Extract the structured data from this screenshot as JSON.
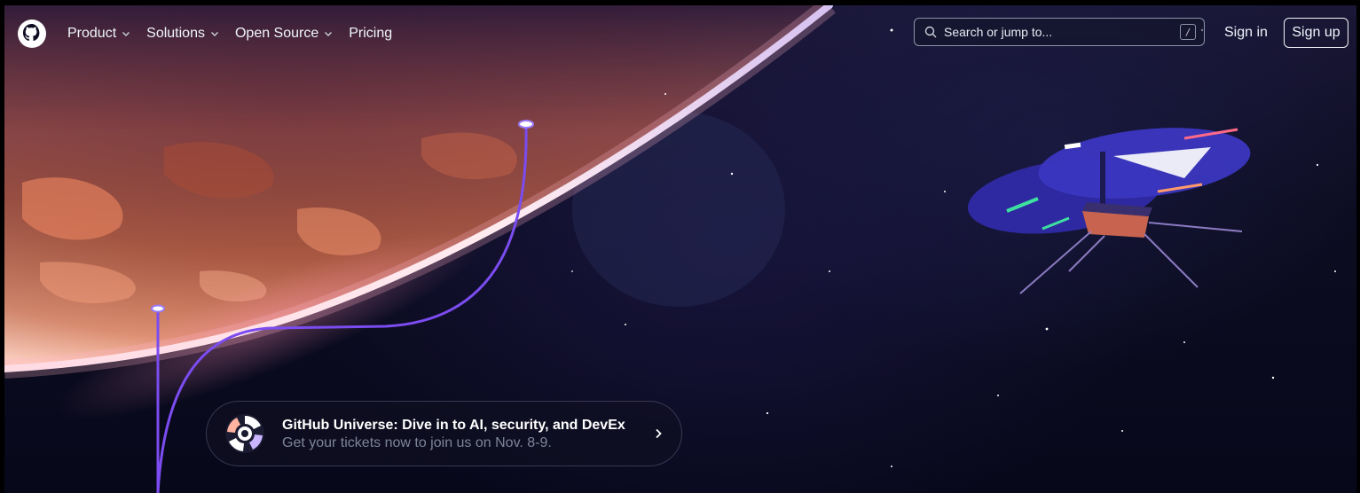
{
  "header": {
    "logo_icon": "github-octocat-icon",
    "nav": [
      {
        "label": "Product",
        "has_dropdown": true
      },
      {
        "label": "Solutions",
        "has_dropdown": true
      },
      {
        "label": "Open Source",
        "has_dropdown": true
      },
      {
        "label": "Pricing",
        "has_dropdown": false
      }
    ],
    "search": {
      "placeholder": "Search or jump to...",
      "shortcut": "/"
    },
    "sign_in": "Sign in",
    "sign_up": "Sign up"
  },
  "banner": {
    "icon": "github-universe-logo-icon",
    "title": "GitHub Universe: Dive in to AI, security, and DevEx",
    "subtitle": "Get your tickets now to join us on Nov. 8-9.",
    "arrow_icon": "chevron-right-icon"
  },
  "colors": {
    "text": "#f0f6fc",
    "muted": "#7d8498",
    "planet": "#d86a4a",
    "accent_line": "#7b4cf0"
  }
}
